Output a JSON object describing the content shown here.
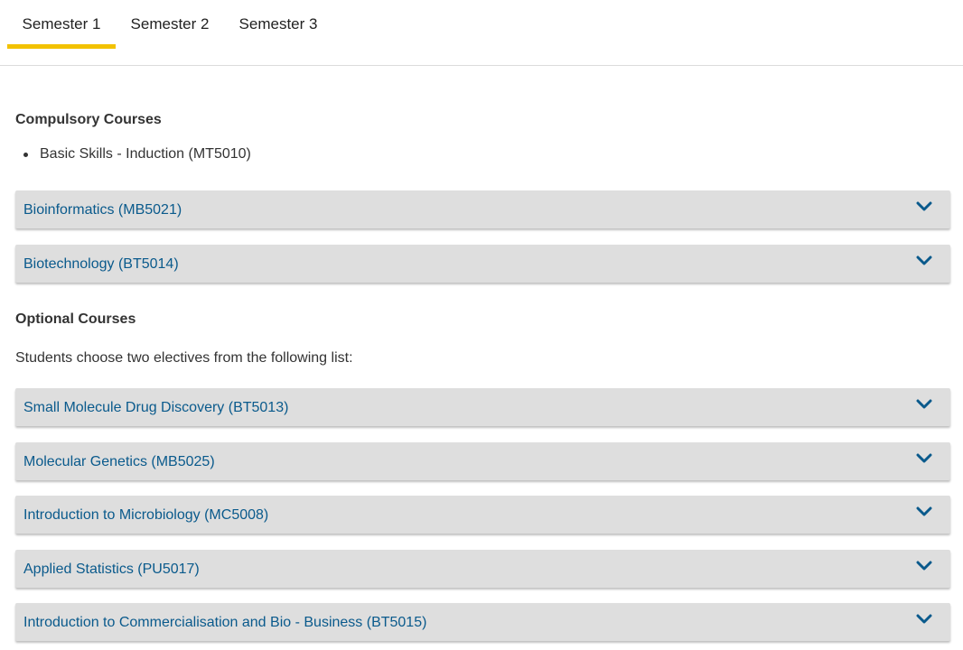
{
  "tabs": [
    {
      "label": "Semester 1",
      "active": true
    },
    {
      "label": "Semester 2",
      "active": false
    },
    {
      "label": "Semester 3",
      "active": false
    }
  ],
  "compulsory": {
    "heading": "Compulsory Courses",
    "bullets": [
      "Basic Skills - Induction (MT5010)"
    ],
    "accordions": [
      "Bioinformatics (MB5021)",
      "Biotechnology (BT5014)"
    ]
  },
  "optional": {
    "heading": "Optional Courses",
    "intro": "Students choose two electives from the following list:",
    "accordions": [
      "Small Molecule Drug Discovery (BT5013)",
      "Molecular Genetics (MB5025)",
      "Introduction to Microbiology (MC5008)",
      "Applied Statistics (PU5017)",
      "Introduction to Commercialisation and Bio - Business (BT5015)"
    ]
  },
  "icons": {
    "accordion_toggle": "chevron-down-icon"
  },
  "colors": {
    "tab_indicator": "#f2c200",
    "link": "#0a5a8c",
    "accordion_bg": "#dedede"
  }
}
